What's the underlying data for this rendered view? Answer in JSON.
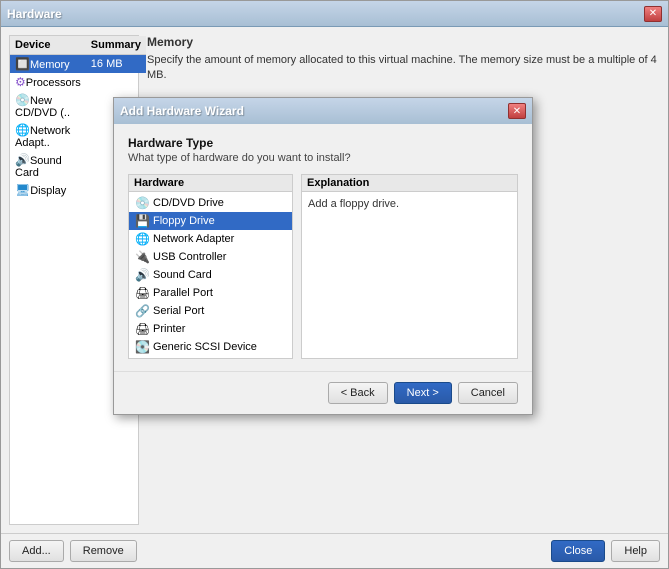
{
  "main_window": {
    "title": "Hardware",
    "close_label": "✕"
  },
  "device_table": {
    "col_device": "Device",
    "col_summary": "Summary",
    "rows": [
      {
        "icon": "🔲",
        "device": "Memory",
        "summary": "16 MB",
        "selected": true
      },
      {
        "icon": "⚙",
        "device": "Processors",
        "summary": ""
      },
      {
        "icon": "💿",
        "device": "New CD/DVD (..",
        "summary": ""
      },
      {
        "icon": "🌐",
        "device": "Network Adapt..",
        "summary": ""
      },
      {
        "icon": "🔊",
        "device": "Sound Card",
        "summary": ""
      },
      {
        "icon": "🖥",
        "device": "Display",
        "summary": ""
      }
    ]
  },
  "right_panel": {
    "title": "Memory",
    "description": "Specify the amount of memory allocated to this virtual machine. The memory size must be a multiple of 4 MB."
  },
  "bottom_buttons": {
    "add_label": "Add...",
    "remove_label": "Remove",
    "close_label": "Close",
    "help_label": "Help"
  },
  "modal": {
    "title": "Add Hardware Wizard",
    "close_label": "✕",
    "section_title": "Hardware Type",
    "section_subtitle": "What type of hardware do you want to install?",
    "hardware_list_header": "Hardware",
    "explanation_header": "Explanation",
    "explanation_text": "Add a floppy drive.",
    "hardware_items": [
      {
        "label": "CD/DVD Drive",
        "icon": "💿",
        "selected": false
      },
      {
        "label": "Floppy Drive",
        "icon": "💾",
        "selected": true
      },
      {
        "label": "Network Adapter",
        "icon": "🌐",
        "selected": false
      },
      {
        "label": "USB Controller",
        "icon": "🔌",
        "selected": false
      },
      {
        "label": "Sound Card",
        "icon": "🔊",
        "selected": false
      },
      {
        "label": "Parallel Port",
        "icon": "🖨",
        "selected": false
      },
      {
        "label": "Serial Port",
        "icon": "🔗",
        "selected": false
      },
      {
        "label": "Printer",
        "icon": "🖨",
        "selected": false
      },
      {
        "label": "Generic SCSI Device",
        "icon": "💽",
        "selected": false
      }
    ],
    "back_label": "< Back",
    "next_label": "Next >",
    "cancel_label": "Cancel"
  }
}
